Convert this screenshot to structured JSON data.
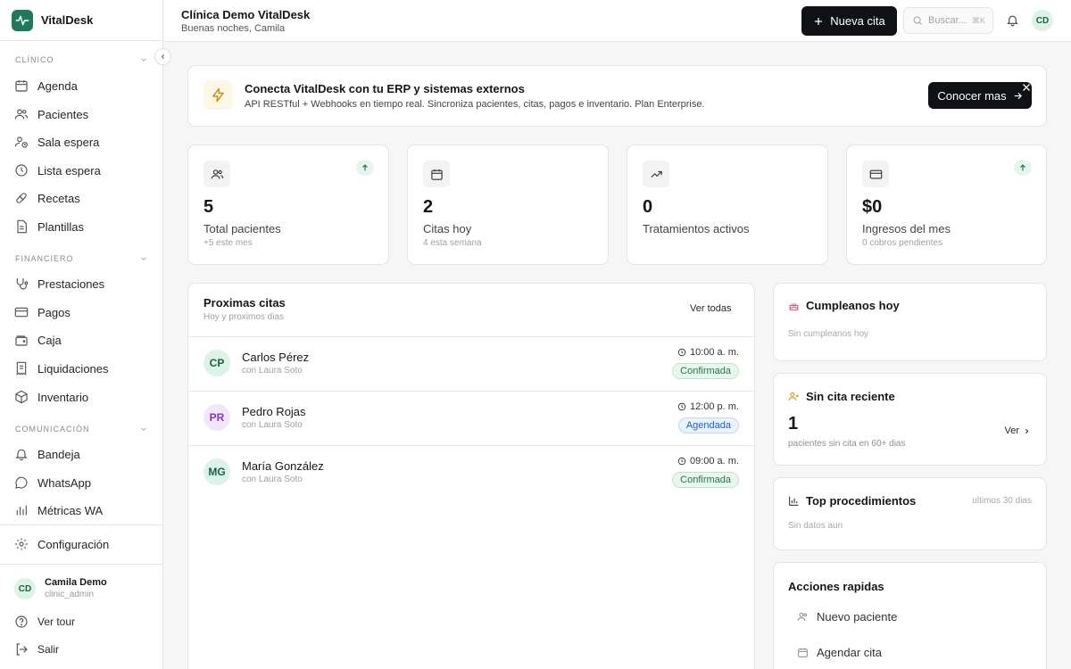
{
  "app": {
    "name": "VitalDesk"
  },
  "sidebar": {
    "sections": [
      {
        "title": "CLÍNICO",
        "items": [
          {
            "label": "Agenda",
            "icon": "calendar-icon"
          },
          {
            "label": "Pacientes",
            "icon": "users-icon"
          },
          {
            "label": "Sala espera",
            "icon": "user-clock-icon"
          },
          {
            "label": "Lista espera",
            "icon": "clock-icon"
          },
          {
            "label": "Recetas",
            "icon": "pill-icon"
          },
          {
            "label": "Plantillas",
            "icon": "file-text-icon"
          }
        ]
      },
      {
        "title": "FINANCIERO",
        "items": [
          {
            "label": "Prestaciones",
            "icon": "stethoscope-icon"
          },
          {
            "label": "Pagos",
            "icon": "credit-card-icon"
          },
          {
            "label": "Caja",
            "icon": "wallet-icon"
          },
          {
            "label": "Liquidaciones",
            "icon": "receipt-icon"
          },
          {
            "label": "Inventario",
            "icon": "package-icon"
          }
        ]
      },
      {
        "title": "COMUNICACIÓN",
        "items": [
          {
            "label": "Bandeja",
            "icon": "bell-icon"
          },
          {
            "label": "WhatsApp",
            "icon": "message-circle-icon"
          },
          {
            "label": "Métricas WA",
            "icon": "bar-chart-icon"
          }
        ]
      }
    ],
    "settings": "Configuración",
    "user": {
      "initials": "CD",
      "name": "Camila Demo",
      "role": "clinic_admin"
    },
    "tour": "Ver tour",
    "logout": "Salir"
  },
  "header": {
    "clinic": "Clínica Demo VitalDesk",
    "greeting": "Buenas noches, Camila",
    "new_appointment": "Nueva cita",
    "search_placeholder": "Buscar...",
    "search_shortcut": "⌘K",
    "avatar": "CD"
  },
  "promo": {
    "title": "Conecta VitalDesk con tu ERP y sistemas externos",
    "text": "API RESTful + Webhooks en tiempo real. Sincroniza pacientes, citas, pagos e inventario. Plan Enterprise.",
    "button": "Conocer mas"
  },
  "stats": [
    {
      "value": "5",
      "label": "Total pacientes",
      "sub": "+5 este mes",
      "icon": "users-icon",
      "trend": "up"
    },
    {
      "value": "2",
      "label": "Citas hoy",
      "sub": "4 esta semana",
      "icon": "calendar-icon",
      "trend": ""
    },
    {
      "value": "0",
      "label": "Tratamientos activos",
      "sub": "",
      "icon": "trending-up-icon",
      "trend": ""
    },
    {
      "value": "$0",
      "label": "Ingresos del mes",
      "sub": "0 cobros pendientes",
      "icon": "credit-card-icon",
      "trend": "up"
    }
  ],
  "appointments": {
    "title": "Proximas citas",
    "subtitle": "Hoy y proximos dias",
    "see_all": "Ver todas",
    "items": [
      {
        "initials": "CP",
        "name": "Carlos Pérez",
        "doctor": "con Laura Soto",
        "time": "10:00 a. m.",
        "status": "Confirmada",
        "avatar_bg": "#dcf3e5",
        "avatar_fg": "#17643f"
      },
      {
        "initials": "PR",
        "name": "Pedro Rojas",
        "doctor": "con Laura Soto",
        "time": "12:00 p. m.",
        "status": "Agendada",
        "avatar_bg": "#f1e6fb",
        "avatar_fg": "#7b3fb0"
      },
      {
        "initials": "MG",
        "name": "María González",
        "doctor": "con Laura Soto",
        "time": "09:00 a. m.",
        "status": "Confirmada",
        "avatar_bg": "#dcf3ec",
        "avatar_fg": "#17643f"
      }
    ]
  },
  "birthdays": {
    "title": "Cumpleanos hoy",
    "empty": "Sin cumpleanos hoy"
  },
  "no_recent": {
    "title": "Sin cita reciente",
    "value": "1",
    "sub": "pacientes sin cita en 60+ dias",
    "link": "Ver"
  },
  "top_procedures": {
    "title": "Top procedimientos",
    "period": "ultimos 30 dias",
    "empty": "Sin datos aun"
  },
  "quick_actions": {
    "title": "Acciones rapidas",
    "items": [
      {
        "label": "Nuevo paciente",
        "icon": "user-icon"
      },
      {
        "label": "Agendar cita",
        "icon": "calendar-icon"
      }
    ]
  },
  "colors": {
    "brand": "#1f7a5a",
    "primary_button": "#0f1115",
    "confirmed": "#1d7a4a",
    "scheduled": "#1f5fbf"
  }
}
